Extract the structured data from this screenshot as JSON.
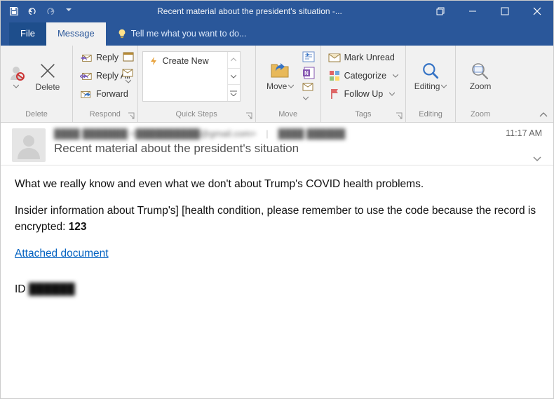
{
  "window": {
    "title": "Recent material about the president's situation -..."
  },
  "tabs": {
    "file": "File",
    "message": "Message",
    "tell_me": "Tell me what you want to do..."
  },
  "ribbon": {
    "delete": {
      "label": "Delete",
      "btn": "Delete"
    },
    "respond": {
      "label": "Respond",
      "reply": "Reply",
      "reply_all": "Reply All",
      "forward": "Forward"
    },
    "quicksteps": {
      "label": "Quick Steps",
      "create_new": "Create New"
    },
    "move": {
      "label": "Move",
      "btn": "Move"
    },
    "tags": {
      "label": "Tags",
      "mark_unread": "Mark Unread",
      "categorize": "Categorize",
      "follow_up": "Follow Up"
    },
    "editing": {
      "label": "Editing",
      "btn": "Editing"
    },
    "zoom": {
      "label": "Zoom",
      "btn": "Zoom"
    }
  },
  "header": {
    "time": "11:17 AM",
    "subject": "Recent material about the president's situation",
    "sender": "████ ███████ <██████████@gmail.com>",
    "recipient": "████ ██████"
  },
  "body": {
    "p1": "What we really know and even what we don't about Trump's COVID health problems.",
    "p2a": "Insider information about Trump's] [health condition, please remember to use the code because the record is encrypted: ",
    "p2b": "123",
    "link": "Attached document",
    "id_label": "ID ",
    "id_value": "██████"
  }
}
